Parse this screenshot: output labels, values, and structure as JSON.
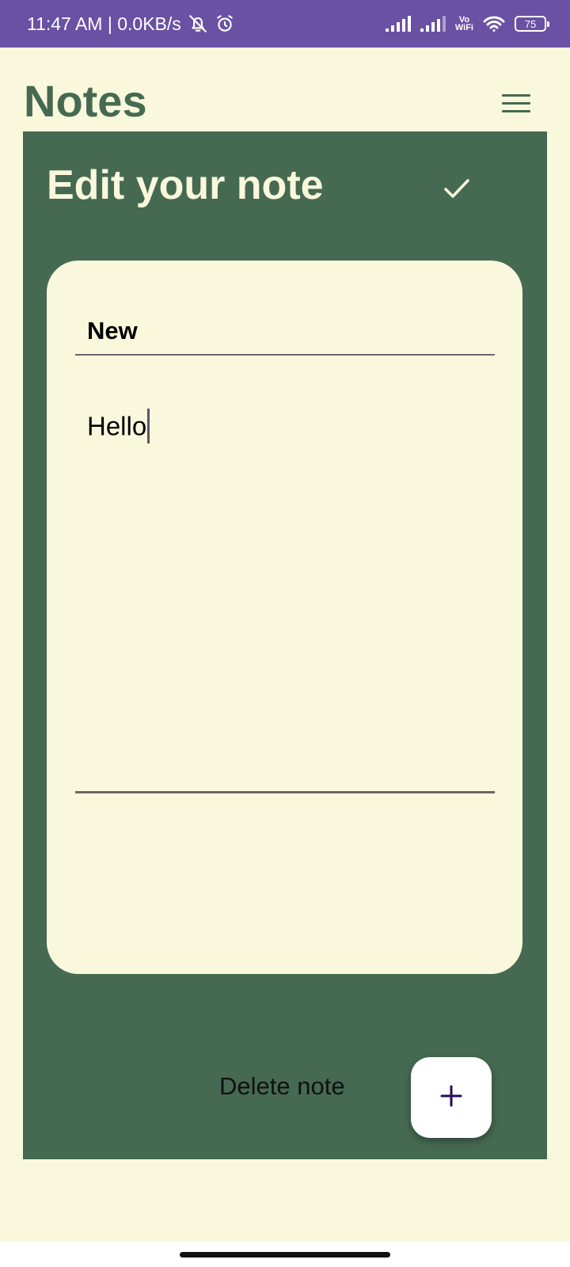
{
  "status_bar": {
    "time_and_speed": "11:47 AM | 0.0KB/s",
    "vowifi_top": "Vo",
    "vowifi_bottom": "WiFi",
    "battery_level": "75"
  },
  "header": {
    "app_title": "Notes",
    "menu_icon": "hamburger-menu-icon"
  },
  "panel": {
    "title": "Edit your note",
    "save_icon": "check-icon"
  },
  "editor": {
    "note_title": "New",
    "note_body": "Hello"
  },
  "actions": {
    "delete_label": "Delete note",
    "add_icon": "plus-icon"
  },
  "colors": {
    "status_bar": "#6A51A3",
    "background": "#FAF8DC",
    "accent_green": "#456A51",
    "add_icon": "#2A0A5A"
  }
}
